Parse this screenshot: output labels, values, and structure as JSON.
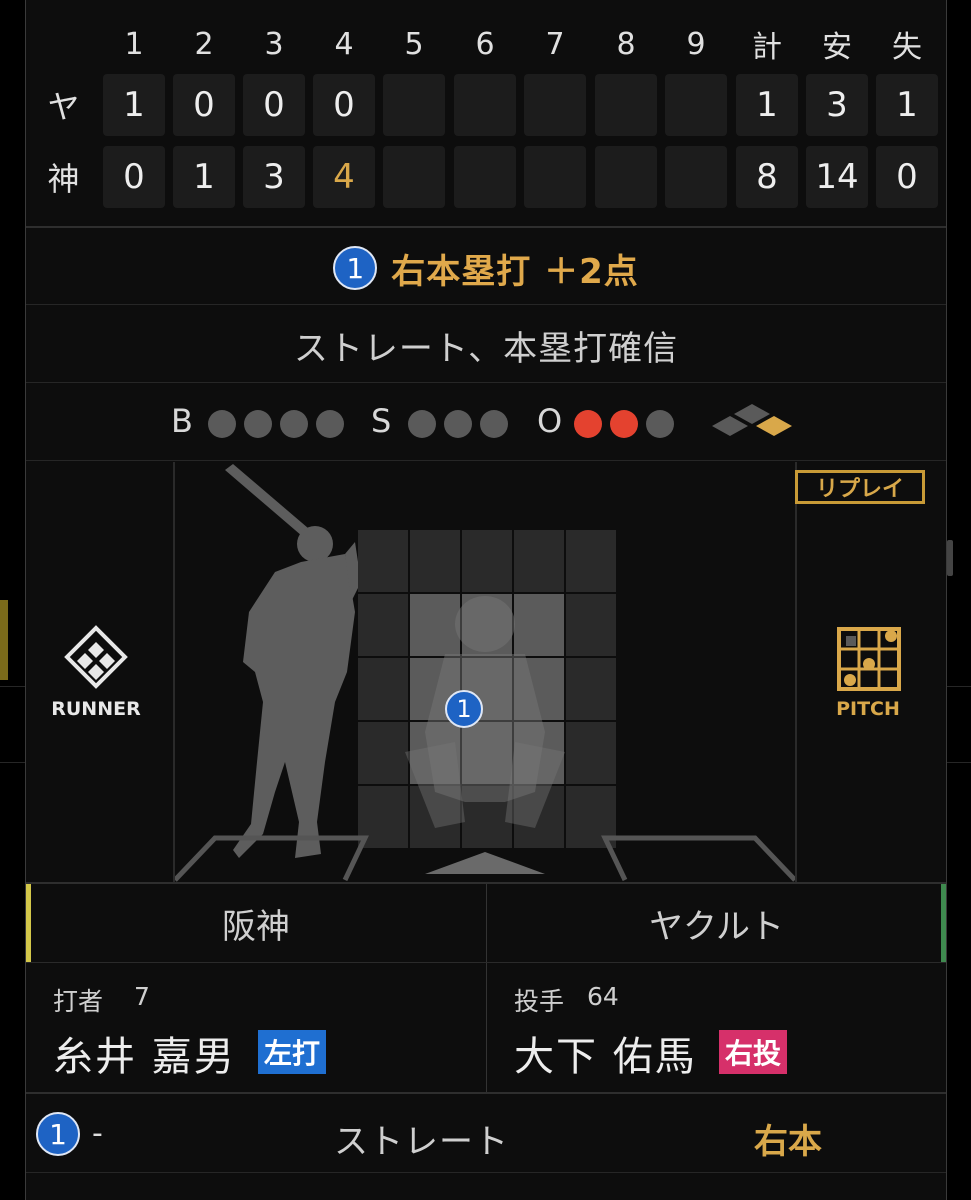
{
  "scoreboard": {
    "headers": [
      "1",
      "2",
      "3",
      "4",
      "5",
      "6",
      "7",
      "8",
      "9",
      "計",
      "安",
      "失"
    ],
    "rows": [
      {
        "team": "ヤ",
        "innings": [
          "1",
          "0",
          "0",
          "0",
          "",
          "",
          "",
          "",
          ""
        ],
        "totals": [
          "1",
          "3",
          "1"
        ]
      },
      {
        "team": "神",
        "innings": [
          "0",
          "1",
          "3",
          "4",
          "",
          "",
          "",
          "",
          ""
        ],
        "totals": [
          "8",
          "14",
          "0"
        ]
      }
    ]
  },
  "play": {
    "number": "1",
    "text": "右本塁打 ＋2点"
  },
  "description": "ストレート、本塁打確信",
  "count": {
    "b_label": "B",
    "s_label": "S",
    "o_label": "O",
    "balls": 0,
    "strikes": 0,
    "outs": 2
  },
  "field": {
    "replay_label": "リプレイ",
    "runner_label": "RUNNER",
    "pitch_label": "PITCH",
    "pitch_marker": "1"
  },
  "teams": {
    "home": "阪神",
    "away": "ヤクルト"
  },
  "batter": {
    "role": "打者",
    "number": "7",
    "name": "糸井 嘉男",
    "hand": "左打"
  },
  "pitcher": {
    "role": "投手",
    "number": "64",
    "name": "大下 佑馬",
    "hand": "右投"
  },
  "pitch_row": {
    "number": "1",
    "dash": "-",
    "type": "ストレート",
    "result": "右本"
  },
  "colors": {
    "accent_gold": "#d9a84a",
    "ball_blue": "#1e63c4",
    "out_red": "#e4422f",
    "batter_badge": "#1f6fd1",
    "pitcher_badge": "#d6306a",
    "home_bar": "#d4c84a",
    "away_bar": "#3f8a4f"
  }
}
